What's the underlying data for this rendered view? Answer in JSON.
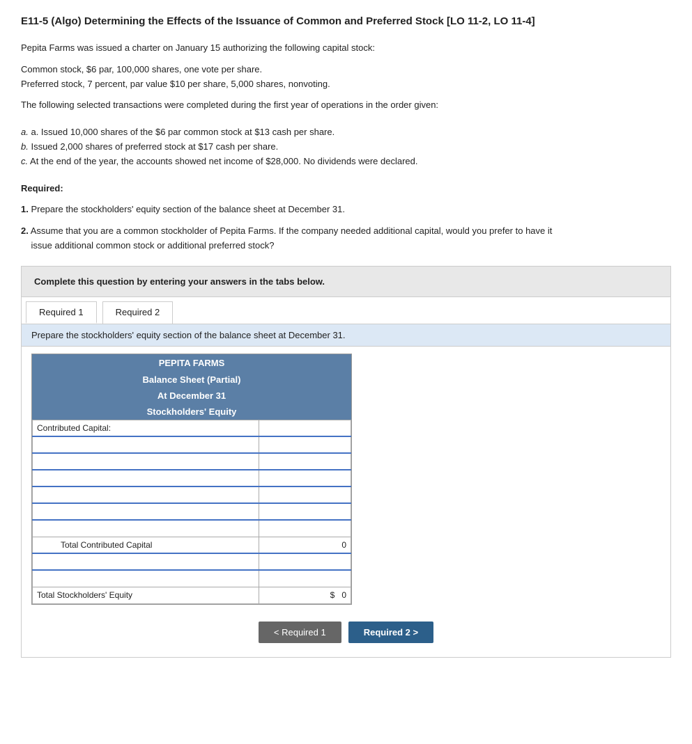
{
  "title": "E11-5 (Algo) Determining the Effects of the Issuance of Common and Preferred Stock [LO 11-2, LO 11-4]",
  "intro": "Pepita Farms was issued a charter on January 15 authorizing the following capital stock:",
  "stock_lines": [
    "Common stock, $6 par, 100,000 shares, one vote per share.",
    "Preferred stock, 7 percent, par value $10 per share, 5,000 shares, nonvoting."
  ],
  "transactions_intro": "The following selected transactions were completed during the first year of operations in the order given:",
  "transactions": [
    "a. Issued 10,000 shares of the $6 par common stock at $13 cash per share.",
    "b. Issued 2,000 shares of preferred stock at $17 cash per share.",
    "c. At the end of the year, the accounts showed net income of $28,000. No dividends were declared."
  ],
  "required_label": "Required:",
  "required_items": [
    "1. Prepare the stockholders' equity section of the balance sheet at December 31.",
    "2. Assume that you are a common stockholder of Pepita Farms. If the company needed additional capital, would you prefer to have it issue additional common stock or additional preferred stock?"
  ],
  "instruction_box": "Complete this question by entering your answers in the tabs below.",
  "tabs": [
    {
      "label": "Required 1",
      "active": true
    },
    {
      "label": "Required 2",
      "active": false
    }
  ],
  "tab_content_header": "Prepare the stockholders' equity section of the balance sheet at December 31.",
  "table": {
    "company": "PEPITA FARMS",
    "subtitle1": "Balance Sheet (Partial)",
    "subtitle2": "At December 31",
    "subtitle3": "Stockholders' Equity",
    "contributed_capital_label": "Contributed Capital:",
    "input_rows": [
      {
        "label": "",
        "value": ""
      },
      {
        "label": "",
        "value": ""
      },
      {
        "label": "",
        "value": ""
      },
      {
        "label": "",
        "value": ""
      },
      {
        "label": "",
        "value": ""
      },
      {
        "label": "",
        "value": ""
      }
    ],
    "total_contributed": {
      "label": "Total Contributed Capital",
      "value": "0"
    },
    "extra_rows": [
      {
        "label": "",
        "value": ""
      },
      {
        "label": "",
        "value": ""
      }
    ],
    "total_equity": {
      "label": "Total Stockholders' Equity",
      "currency": "$",
      "value": "0"
    }
  },
  "nav": {
    "prev_label": "< Required 1",
    "next_label": "Required 2  >"
  }
}
